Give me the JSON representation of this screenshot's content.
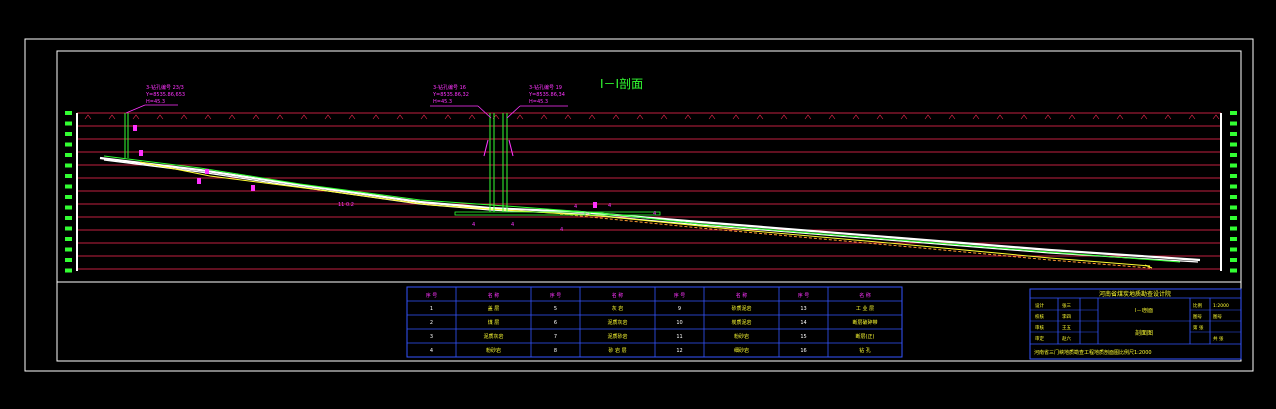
{
  "drawing": {
    "section_title": "I－I剖面",
    "annotation_left": [
      "3-钻孔编号 23/3",
      "Y=8535.86,653",
      "H=45.3"
    ],
    "annotation_mid1": [
      "3-钻孔编号 16",
      "Y=8535.86,32",
      "H=45.3"
    ],
    "annotation_mid2": [
      "3-钻孔编号 19",
      "Y=8535.86,34",
      "H=45.3"
    ],
    "slope_label": "11 0.2",
    "marker_labels": [
      "4",
      "4",
      "4",
      "4",
      "4",
      "4"
    ]
  },
  "legend": {
    "headers": [
      "序 号",
      "名 称",
      "序 号",
      "名 称",
      "序 号",
      "名 称",
      "序 号",
      "名 称"
    ],
    "rows": [
      [
        "1",
        "盖 层",
        "5",
        "灰 岩",
        "9",
        "砂质泥岩",
        "13",
        "工 业 层"
      ],
      [
        "2",
        "煤 层",
        "6",
        "泥质灰岩",
        "10",
        "炭质泥岩",
        "14",
        "断层破碎带"
      ],
      [
        "3",
        "泥质灰岩",
        "7",
        "泥质砂岩",
        "11",
        "粉砂岩",
        "15",
        "断层(正)"
      ],
      [
        "4",
        "粉砂岩",
        "8",
        "砂 岩 层",
        "12",
        "细砂岩",
        "16",
        "钻 孔"
      ]
    ]
  },
  "title_block": {
    "company": "河南省煤炭地质勘查设计院",
    "project": "河南省三门峡地质勘查工程",
    "drawing_name": "剖面图",
    "sub_name": "I－I剖面",
    "scale_label": "比例",
    "scale_value": "1:2000",
    "sheet_label": "图号",
    "sheet_value": "图号",
    "page_label": "第 张",
    "page_value": "共 张",
    "roles": [
      "设计",
      "校核",
      "审核",
      "审定"
    ],
    "names": [
      "张三",
      "李四",
      "王五",
      "赵六"
    ],
    "footer": "河南省三门峡地质勘查工程地质剖面图比例尺1:2000"
  },
  "colors": {
    "background": "#000000",
    "frame": "#ffffff",
    "grid": "#ff2a55",
    "magenta": "#ff33ff",
    "green": "#33ff33",
    "yellow": "#ffff33",
    "blue": "#3355ff",
    "orange": "#ff9933"
  }
}
